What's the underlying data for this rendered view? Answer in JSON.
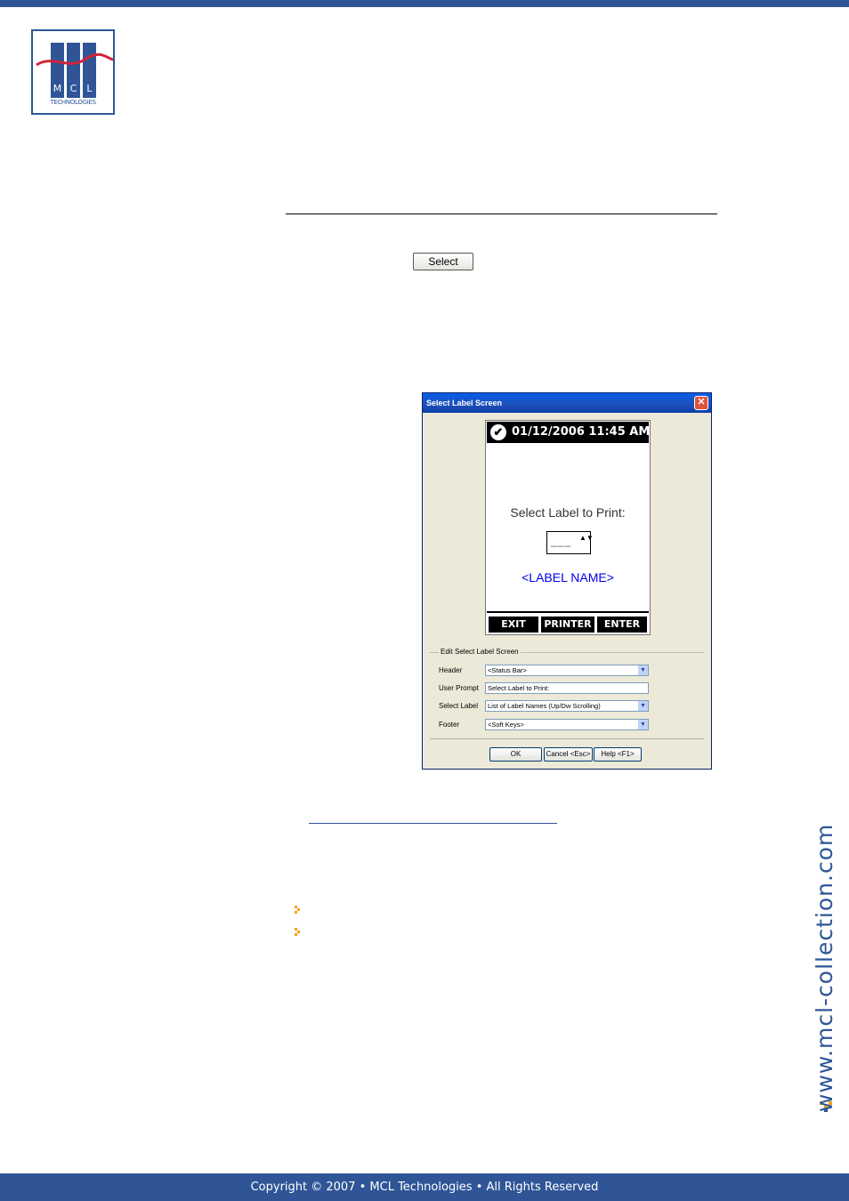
{
  "colors": {
    "brand": "#2f5597",
    "bullet": "#f7a11a",
    "logo_wave": "#d0243a"
  },
  "logo": {
    "letters": [
      "M",
      "C",
      "L"
    ],
    "subtitle": "TECHNOLOGIES"
  },
  "select_button": {
    "label": "Select"
  },
  "dialog": {
    "title": "Select Label Screen",
    "close_glyph": "✕",
    "phone": {
      "check_glyph": "✔",
      "datetime": "01/12/2006 11:45 AM",
      "prompt": "Select Label to Print:",
      "spinner_value": "___",
      "spinner_arrows": "▲▼",
      "label_name": "<LABEL NAME>",
      "softkeys": [
        "EXIT",
        "PRINTER",
        "ENTER"
      ]
    },
    "group_title": "Edit Select Label Screen",
    "fields": {
      "header": {
        "label": "Header",
        "value": "<Status Bar>"
      },
      "user_prompt": {
        "label": "User Prompt",
        "value": "Select Label to Print:"
      },
      "select_label": {
        "label": "Select Label",
        "value": "List of Label Names (Up/Dw Scrolling)"
      },
      "footer": {
        "label": "Footer",
        "value": "<Soft Keys>"
      }
    },
    "dropdown_glyph": "▼",
    "buttons": {
      "ok": "OK",
      "cancel": "Cancel <Esc>",
      "help": "Help <F1>"
    }
  },
  "side_url": "www.mcl-collection.com",
  "footer_text": "Copyright © 2007 • MCL Technologies • All Rights Reserved"
}
